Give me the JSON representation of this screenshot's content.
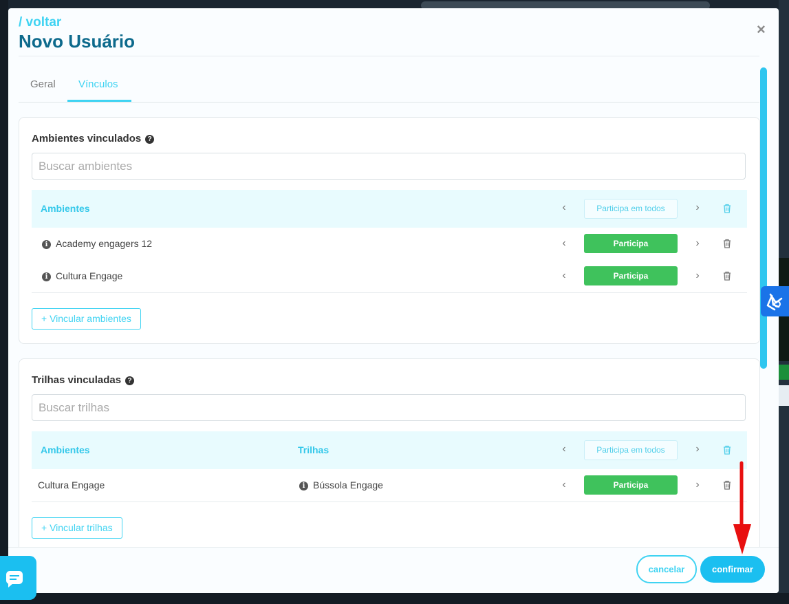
{
  "modal": {
    "back_label": "/ voltar",
    "title": "Novo Usuário",
    "close_label": "×"
  },
  "tabs": [
    {
      "label": "Geral",
      "active": false
    },
    {
      "label": "Vínculos",
      "active": true
    }
  ],
  "ambientes": {
    "title": "Ambientes vinculados",
    "search_placeholder": "Buscar ambientes",
    "header_label": "Ambientes",
    "participate_all_label": "Participa em todos",
    "rows": [
      {
        "name": "Academy engagers 12",
        "status": "Participa"
      },
      {
        "name": "Cultura Engage",
        "status": "Participa"
      }
    ],
    "add_label": "+ Vincular ambientes"
  },
  "trilhas": {
    "title": "Trilhas vinculadas",
    "search_placeholder": "Buscar trilhas",
    "header_ambientes": "Ambientes",
    "header_trilhas": "Trilhas",
    "participate_all_label": "Participa em todos",
    "rows": [
      {
        "ambiente": "Cultura Engage",
        "trilha": "Bússola Engage",
        "status": "Participa"
      }
    ],
    "add_label": "+ Vincular trilhas"
  },
  "footer": {
    "cancel_label": "cancelar",
    "confirm_label": "confirmar"
  },
  "icons": {
    "chev_left": "‹",
    "chev_right": "›",
    "help": "?",
    "info": "i"
  },
  "colors": {
    "accent": "#3fd3f2",
    "title": "#0d6a8c",
    "success": "#3fc25c",
    "confirm": "#1bbff0",
    "arrow": "#e81010"
  }
}
